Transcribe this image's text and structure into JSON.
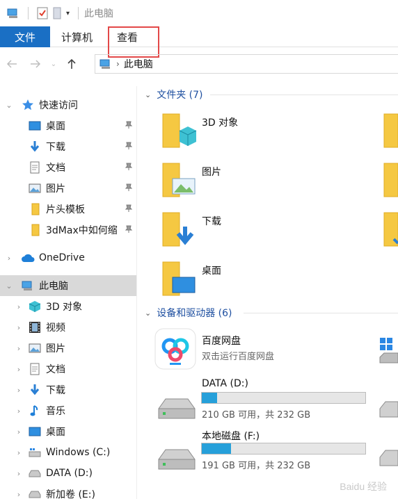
{
  "window": {
    "title": "此电脑"
  },
  "ribbon": {
    "file": "文件",
    "computer": "计算机",
    "view": "查看"
  },
  "address": {
    "crumb": "此电脑"
  },
  "nav": {
    "quick_access": "快速访问",
    "desktop": "桌面",
    "downloads": "下载",
    "documents": "文档",
    "pictures": "图片",
    "clip_template": "片头模板",
    "max_folder": "3dMax中如何缩",
    "onedrive": "OneDrive",
    "this_pc": "此电脑",
    "pc_3d": "3D 对象",
    "pc_video": "视频",
    "pc_pictures": "图片",
    "pc_documents": "文档",
    "pc_downloads": "下载",
    "pc_music": "音乐",
    "pc_desktop": "桌面",
    "drive_c": "Windows (C:)",
    "drive_d": "DATA (D:)",
    "drive_e": "新加卷 (E:)"
  },
  "content": {
    "folders_header": "文件夹 (7)",
    "folders": [
      "3D 对象",
      "图片",
      "下载",
      "桌面"
    ],
    "devices_header": "设备和驱动器 (6)",
    "baidu": {
      "name": "百度网盘",
      "sub": "双击运行百度网盘"
    },
    "drive_d": {
      "name": "DATA (D:)",
      "info": "210 GB 可用，共 232 GB",
      "used_fraction": 0.095
    },
    "drive_f": {
      "name": "本地磁盘 (F:)",
      "info": "191 GB 可用，共 232 GB",
      "used_fraction": 0.177
    }
  },
  "watermark": "Baidu 经验",
  "colors": {
    "accent": "#1a6fc4",
    "folder": "#f5c842",
    "selected": "#d9d9d9",
    "highlight": "#e34848",
    "drive_bar": "#26a0da"
  }
}
